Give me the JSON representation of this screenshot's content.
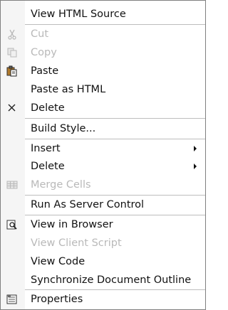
{
  "menu": {
    "items": [
      {
        "label": "View HTML Source",
        "disabled": false,
        "icon": ""
      },
      {
        "label": "Cut",
        "disabled": true,
        "icon": "scissors-icon"
      },
      {
        "label": "Copy",
        "disabled": true,
        "icon": "copy-icon"
      },
      {
        "label": "Paste",
        "disabled": false,
        "icon": "clipboard-icon"
      },
      {
        "label": "Paste as HTML",
        "disabled": false,
        "icon": ""
      },
      {
        "label": "Delete",
        "disabled": false,
        "icon": "x-icon"
      },
      {
        "label": "Build Style...",
        "disabled": false,
        "icon": ""
      },
      {
        "label": "Insert",
        "disabled": false,
        "icon": "",
        "submenu": true
      },
      {
        "label": "Delete",
        "disabled": false,
        "icon": "",
        "submenu": true
      },
      {
        "label": "Merge Cells",
        "disabled": true,
        "icon": "table-icon"
      },
      {
        "label": "Run As Server Control",
        "disabled": false,
        "icon": ""
      },
      {
        "label": "View in Browser",
        "disabled": false,
        "icon": "browser-preview-icon"
      },
      {
        "label": "View Client Script",
        "disabled": true,
        "icon": ""
      },
      {
        "label": "View Code",
        "disabled": false,
        "icon": ""
      },
      {
        "label": "Synchronize Document Outline",
        "disabled": false,
        "icon": ""
      },
      {
        "label": "Properties",
        "disabled": false,
        "icon": "properties-icon"
      }
    ]
  }
}
